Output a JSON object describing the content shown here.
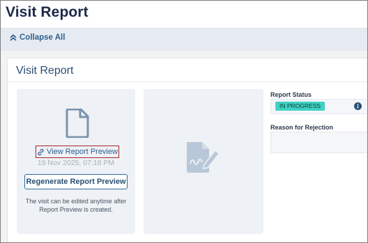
{
  "header": {
    "title": "Visit Report"
  },
  "toolbar": {
    "collapse_all_label": "Collapse All"
  },
  "panel": {
    "title": "Visit Report",
    "preview_card": {
      "view_preview_label": "View Report Preview",
      "timestamp": "19 Nov 2025, 07:18 PM",
      "regenerate_label": "Regenerate Report Preview",
      "note": "The visit can be edited anytime after Report Preview is created."
    },
    "status": {
      "label": "Report Status",
      "value": "IN PROGRESS",
      "badge_color": "#3fd2c4"
    },
    "rejection": {
      "label": "Reason for Rejection",
      "value": ""
    }
  },
  "colors": {
    "accent": "#2f5f8f",
    "highlight_border": "#a5262c"
  },
  "icons": [
    "chevrons-up-icon",
    "document-icon",
    "link-icon",
    "signature-icon",
    "info-icon"
  ]
}
